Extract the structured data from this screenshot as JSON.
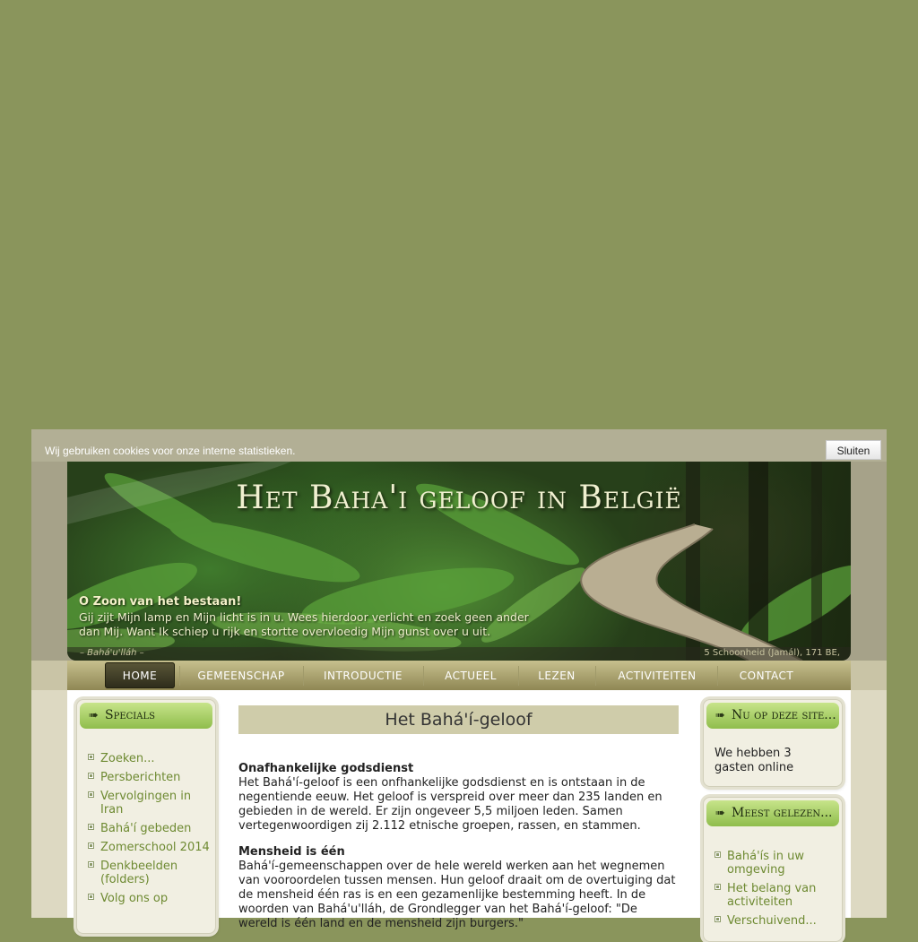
{
  "cookie": {
    "text": "Wij gebruiken cookies voor onze interne statistieken.",
    "close_label": "Sluiten"
  },
  "header": {
    "title": "Het Baha'i geloof in België",
    "quote_title": "O Zoon van het bestaan!",
    "quote_text": "Gij zijt Mijn lamp en Mijn licht is in u. Wees hierdoor verlicht en zoek geen ander dan Mij. Want Ik schiep u rijk en stortte overvloedig Mijn gunst over u uit.",
    "quote_author": "– Bahá'u'lláh –",
    "quote_ref": "5 Schoonheid (Jamál), 171 BE,"
  },
  "nav": {
    "items": [
      "HOME",
      "GEMEENSCHAP",
      "INTRODUCTIE",
      "ACTUEEL",
      "LEZEN",
      "ACTIVITEITEN",
      "CONTACT"
    ],
    "active": "HOME"
  },
  "sidebar_left": {
    "title": "Specials",
    "links": [
      "Zoeken...",
      "Persberichten",
      "Vervolgingen in Iran",
      "Bahá'í gebeden",
      "Zomerschool 2014",
      "Denkbeelden (folders)",
      "Volg ons op"
    ]
  },
  "sidebar_right": {
    "online_title": "Nu op deze site...",
    "online_text": "We hebben 3 gasten online",
    "popular_title": "Meest gelezen...",
    "popular_links": [
      "Bahá'ís in uw omgeving",
      "Het belang van activiteiten",
      "Verschuivend..."
    ]
  },
  "article": {
    "title": "Het Bahá'í-geloof",
    "sections": [
      {
        "heading": "Onafhankelijke godsdienst",
        "text": "Het Bahá'í-geloof is een onfhankelijke godsdienst en is ontstaan in de negentiende eeuw. Het geloof is verspreid over meer dan 235 landen en gebieden in de wereld. Er zijn ongeveer 5,5 miljoen leden. Samen vertegenwoordigen zij 2.112 etnische groepen, rassen, en stammen."
      },
      {
        "heading": "Mensheid is één",
        "text": "Bahá'í-gemeenschappen over de hele wereld werken aan het wegnemen van vooroordelen tussen mensen. Hun geloof draait om de overtuiging dat de mensheid één ras is en een gezamenlijke bestemming heeft. In de woorden van Bahá'u'lláh, de Grondlegger van het Bahá'í-geloof: \"De wereld is één land en de mensheid zijn burgers.\""
      }
    ]
  },
  "colors": {
    "page_bg": "#8a955c",
    "accent_green": "#8fbd4c",
    "link_green": "#6e8a32",
    "nav_gold": "#8f8754"
  }
}
